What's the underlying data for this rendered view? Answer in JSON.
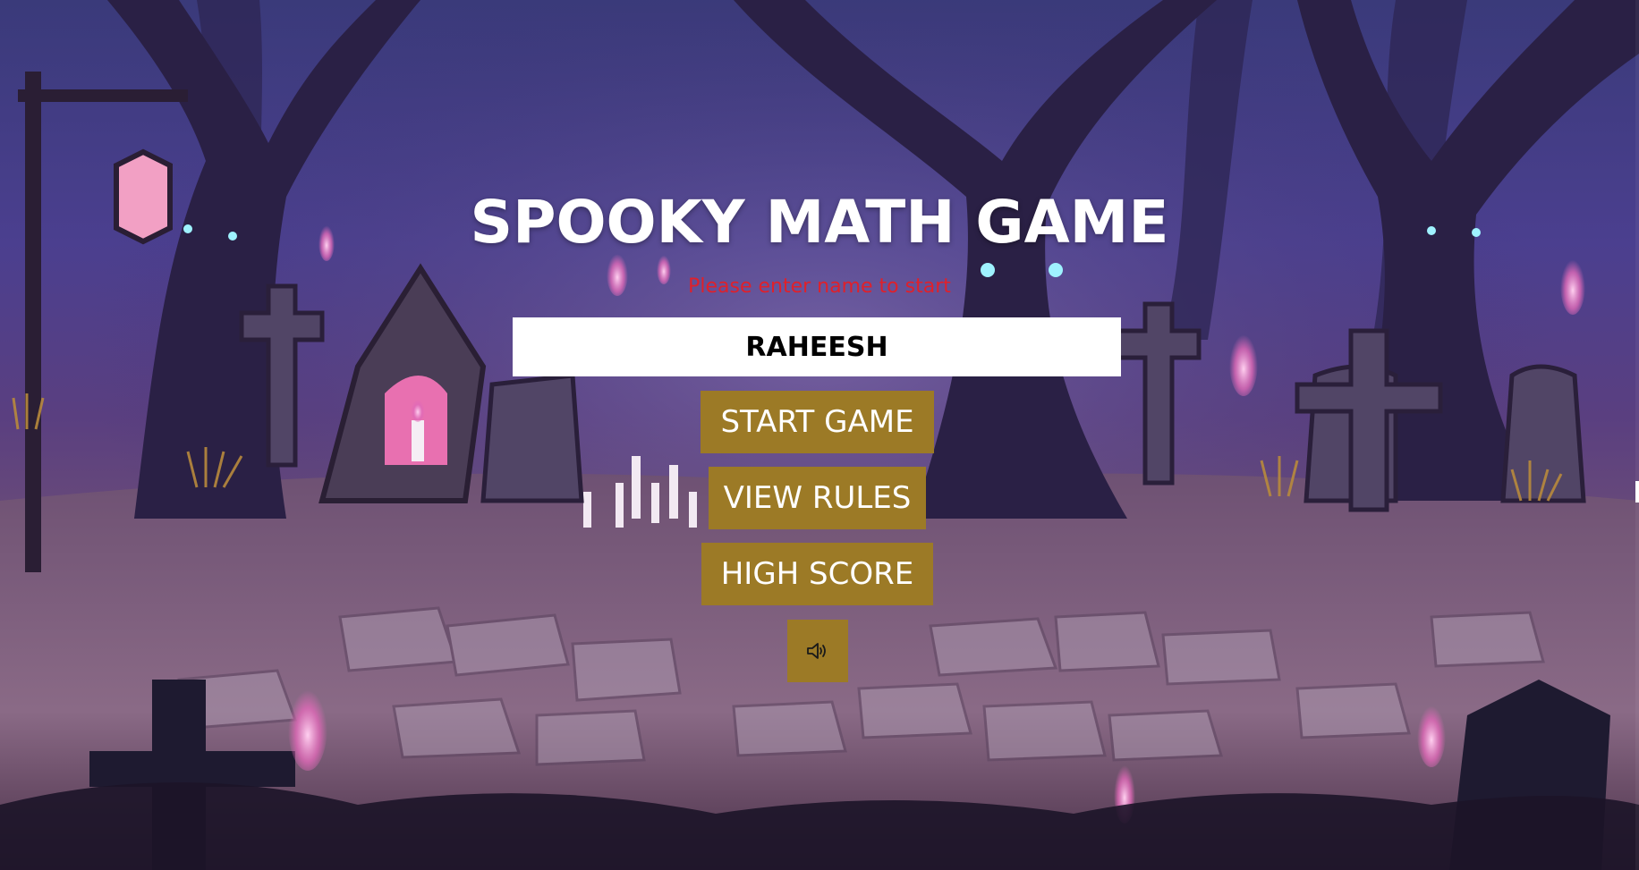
{
  "game": {
    "title": "SPOOKY MATH GAME",
    "prompt": "Please enter name to start",
    "name_input": {
      "value": "RAHEESH",
      "placeholder": ""
    },
    "buttons": {
      "start": "START GAME",
      "rules": "VIEW RULES",
      "high_score": "HIGH SCORE",
      "sound_icon": "speaker-icon"
    }
  },
  "colors": {
    "title": "#ffffff",
    "prompt": "#e0202a",
    "button_bg": "#9c7a26",
    "button_text": "#ffffff",
    "input_bg": "#ffffff"
  }
}
